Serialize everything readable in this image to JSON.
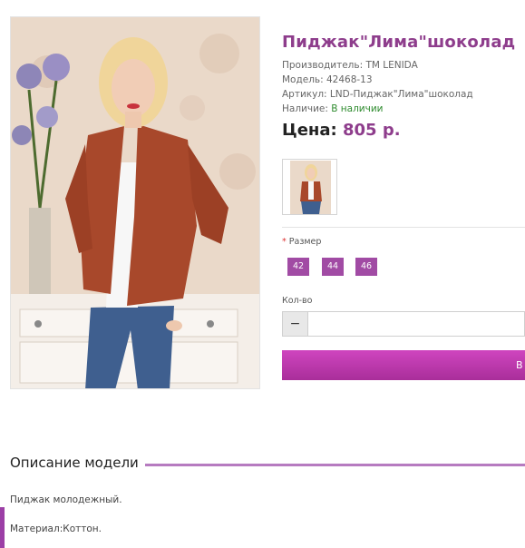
{
  "product": {
    "title": "Пиджак\"Лима\"шоколад",
    "manufacturer": "Производитель: ТМ LENIDA",
    "model": "Модель: 42468-13",
    "article": "Артикул: LND-Пиджак\"Лима\"шоколад",
    "availability_label": "Наличие:",
    "availability_value": "В наличии",
    "price_label": "Цена:",
    "price_value": "805 р."
  },
  "options": {
    "size_required_mark": "*",
    "size_label": "Размер",
    "sizes": [
      "42",
      "44",
      "46"
    ],
    "qty_label": "Кол-во",
    "qty_minus": "−",
    "qty_value": ""
  },
  "buy_button": {
    "label": "В"
  },
  "description": {
    "title": "Описание модели",
    "lines": [
      "Пиджак молодежный.",
      "Материал:Коттон."
    ]
  },
  "colors": {
    "accent": "#8e3d8c",
    "size_button": "#a14ba4",
    "buy_button": "#c33db5",
    "in_stock": "#2e8b2e"
  }
}
